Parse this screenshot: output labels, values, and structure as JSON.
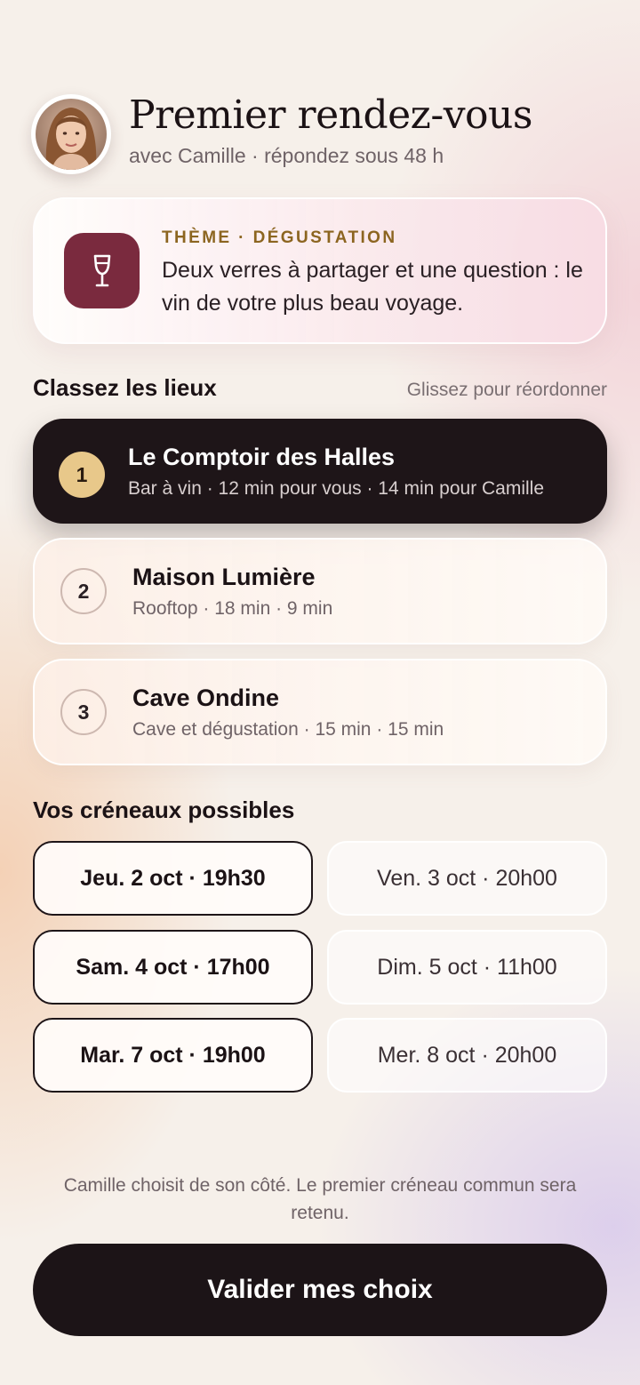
{
  "header": {
    "title": "Premier rendez-vous",
    "subtitle": "avec Camille · répondez sous 48 h"
  },
  "theme": {
    "kicker": "THÈME · DÉGUSTATION",
    "text": "Deux verres à partager et une question : le vin de votre plus beau voyage.",
    "icon": "wine-glass-icon",
    "icon_bg": "#7a2a3e"
  },
  "venues_section": {
    "title": "Classez les lieux",
    "hint": "Glissez pour réordonner"
  },
  "venues": [
    {
      "rank": "1",
      "name": "Le Comptoir des Halles",
      "meta": "Bar à vin · 12 min pour vous · 14 min pour Camille"
    },
    {
      "rank": "2",
      "name": "Maison Lumière",
      "meta": "Rooftop · 18 min · 9 min"
    },
    {
      "rank": "3",
      "name": "Cave Ondine",
      "meta": "Cave et dégustation · 15 min · 15 min"
    }
  ],
  "slots_section": {
    "title": "Vos créneaux possibles"
  },
  "slots": [
    {
      "label": "Jeu. 2 oct · 19h30",
      "selected": true
    },
    {
      "label": "Ven. 3 oct · 20h00",
      "selected": false
    },
    {
      "label": "Sam. 4 oct · 17h00",
      "selected": true
    },
    {
      "label": "Dim. 5 oct · 11h00",
      "selected": false
    },
    {
      "label": "Mar. 7 oct · 19h00",
      "selected": true
    },
    {
      "label": "Mer. 8 oct · 20h00",
      "selected": false
    }
  ],
  "footnote": "Camille choisit de son côté. Le premier créneau commun sera retenu.",
  "cta": {
    "label": "Valider mes choix"
  },
  "colors": {
    "accent_gold": "#e8c88a",
    "dark": "#1c1417",
    "kicker": "#8c6520"
  }
}
